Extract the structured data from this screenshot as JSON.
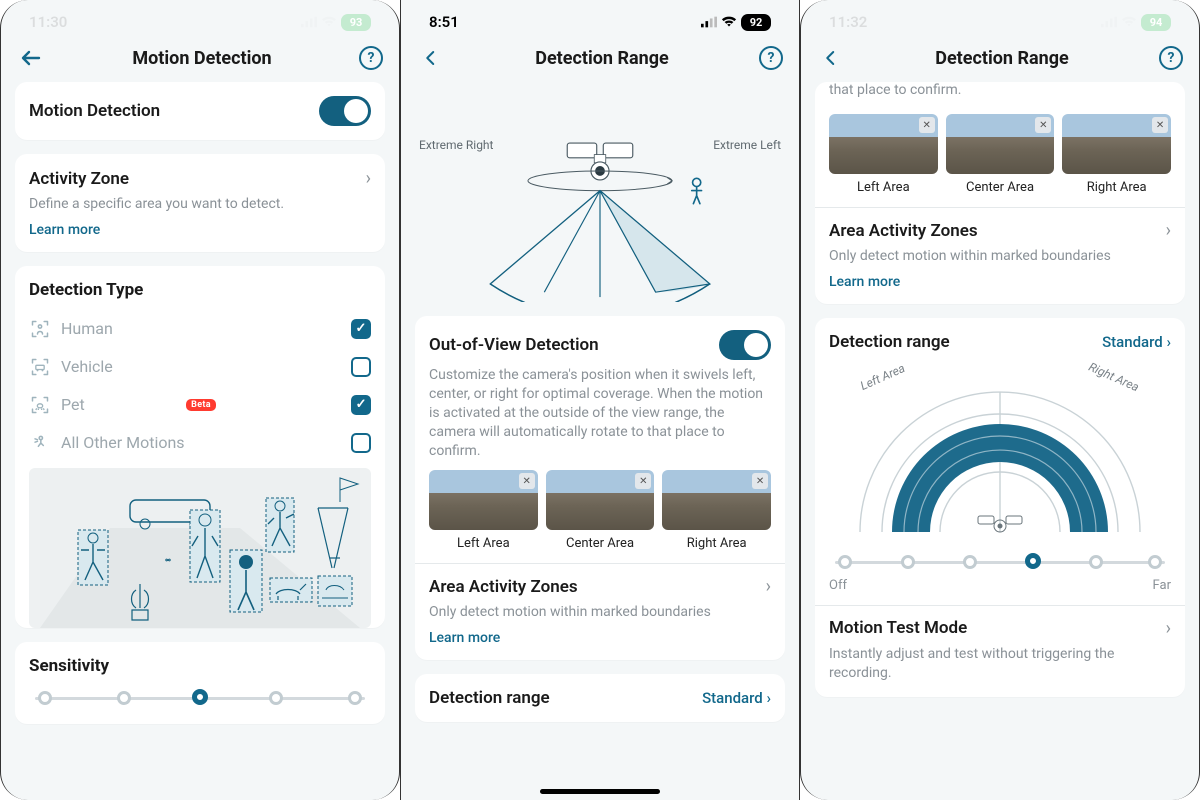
{
  "panel1": {
    "time": "11:30",
    "battery": "93",
    "title": "Motion Detection",
    "motionDetection": {
      "label": "Motion Detection"
    },
    "activityZone": {
      "label": "Activity Zone",
      "desc": "Define a specific area you want to detect.",
      "learn": "Learn more"
    },
    "detectionType": {
      "title": "Detection Type",
      "items": [
        {
          "label": "Human",
          "checked": true,
          "beta": false
        },
        {
          "label": "Vehicle",
          "checked": false,
          "beta": false
        },
        {
          "label": "Pet",
          "checked": true,
          "beta": true
        },
        {
          "label": "All Other Motions",
          "checked": false,
          "beta": false
        }
      ],
      "betaBadge": "Beta"
    },
    "sensitivity": {
      "title": "Sensitivity",
      "steps": 5,
      "active": 2
    }
  },
  "panel2": {
    "time": "8:51",
    "battery": "92",
    "title": "Detection Range",
    "diagram": {
      "left": "Extreme Right",
      "right": "Extreme Left"
    },
    "oov": {
      "label": "Out-of-View Detection",
      "desc": "Customize the camera's position when it swivels left, center, or right for optimal coverage. When the motion is activated at the outside of the view range, the camera will automatically rotate to that place to confirm."
    },
    "thumbs": [
      "Left Area",
      "Center Area",
      "Right Area"
    ],
    "areaZones": {
      "label": "Area Activity Zones",
      "desc": "Only detect motion within marked boundaries",
      "learn": "Learn more"
    },
    "detectionRange": {
      "label": "Detection range",
      "value": "Standard"
    }
  },
  "panel3": {
    "time": "11:32",
    "battery": "94",
    "title": "Detection Range",
    "truncTop": "that place to confirm.",
    "thumbs": [
      "Left Area",
      "Center Area",
      "Right Area"
    ],
    "areaZones": {
      "label": "Area Activity Zones",
      "desc": "Only detect motion within marked boundaries",
      "learn": "Learn more"
    },
    "detectionRange": {
      "label": "Detection range",
      "value": "Standard"
    },
    "radar": {
      "left": "Left Area",
      "right": "Right Area"
    },
    "rangeSlider": {
      "steps": 6,
      "active": 3,
      "leftLabel": "Off",
      "rightLabel": "Far"
    },
    "motionTest": {
      "label": "Motion Test Mode",
      "desc": "Instantly adjust and test without triggering the recording."
    }
  }
}
